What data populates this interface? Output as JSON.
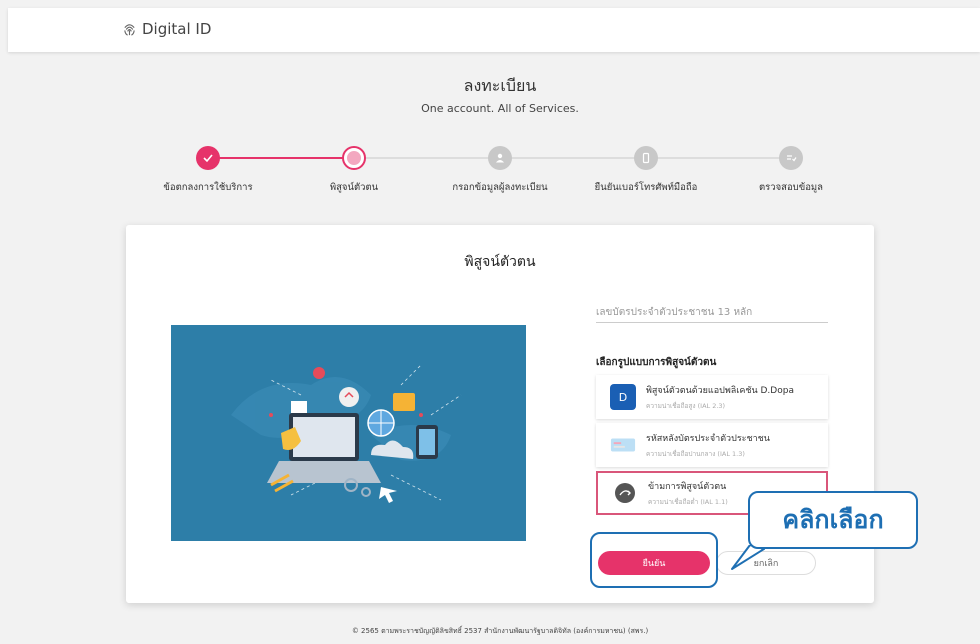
{
  "header": {
    "logo_text": "Digital ID"
  },
  "page": {
    "title": "ลงทะเบียน",
    "subtitle": "One account. All of Services."
  },
  "steps": [
    {
      "label": "ข้อตกลงการใช้บริการ",
      "status": "done"
    },
    {
      "label": "พิสูจน์ตัวตน",
      "status": "current"
    },
    {
      "label": "กรอกข้อมูลผู้ลงทะเบียน",
      "status": "pending",
      "icon": "person-icon"
    },
    {
      "label": "ยืนยันเบอร์โทรศัพท์มือถือ",
      "status": "pending",
      "icon": "phone-icon"
    },
    {
      "label": "ตรวจสอบข้อมูล",
      "status": "pending",
      "icon": "check-list-icon"
    }
  ],
  "card": {
    "title": "พิสูจน์ตัวตน",
    "id_placeholder": "เลขบัตรประจำตัวประชาชน 13 หลัก",
    "method_label": "เลือกรูปแบบการพิสูจน์ตัวตน",
    "options": [
      {
        "title": "พิสูจน์ตัวตนด้วยแอปพลิเคชัน D.Dopa",
        "subtitle": "ความน่าเชื่อถือสูง (IAL 2.3)",
        "icon": "ddopa-app-icon",
        "selected": false
      },
      {
        "title": "รหัสหลังบัตรประจำตัวประชาชน",
        "subtitle": "ความน่าเชื่อถือปานกลาง (IAL 1.3)",
        "icon": "id-card-icon",
        "selected": false
      },
      {
        "title": "ข้ามการพิสูจน์ตัวตน",
        "subtitle": "ความน่าเชื่อถือต่ำ (IAL 1.1)",
        "icon": "skip-icon",
        "selected": true
      }
    ],
    "confirm_label": "ยืนยัน",
    "cancel_label": "ยกเลิก"
  },
  "footer": {
    "text": "© 2565 ตามพระราชบัญญัติลิขสิทธิ์ 2537 สำนักงานพัฒนารัฐบาลดิจิทัล (องค์การมหาชน) (สพร.)"
  },
  "annotation": {
    "callout_text": "คลิกเลือก"
  },
  "colors": {
    "accent": "#e6336a",
    "callout": "#1e6fb3",
    "illustration_bg": "#2d7ea8"
  }
}
